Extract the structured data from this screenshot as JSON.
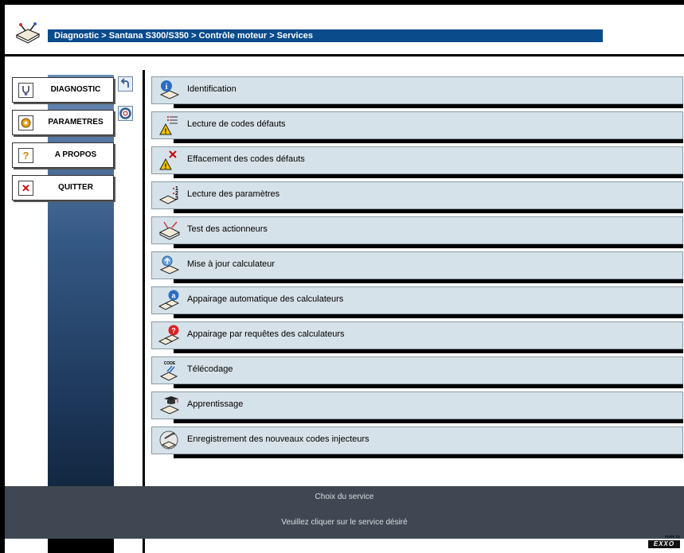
{
  "header": {
    "breadcrumb": "Diagnostic > Santana S300/S350 > Contrôle moteur > Services"
  },
  "nav": {
    "items": [
      {
        "label": "DIAGNOSTIC",
        "icon": "stethoscope-icon"
      },
      {
        "label": "PARAMETRES",
        "icon": "gear-icon"
      },
      {
        "label": "A PROPOS",
        "icon": "question-icon"
      },
      {
        "label": "QUITTER",
        "icon": "close-icon"
      }
    ]
  },
  "tools": [
    {
      "icon": "back-arrow-icon"
    },
    {
      "icon": "help-lifebuoy-icon"
    }
  ],
  "services": [
    {
      "label": "Identification",
      "icon": "identification-icon"
    },
    {
      "label": "Lecture de codes défauts",
      "icon": "read-fault-codes-icon"
    },
    {
      "label": "Effacement des codes défauts",
      "icon": "clear-fault-codes-icon"
    },
    {
      "label": "Lecture des paramètres",
      "icon": "read-parameters-icon"
    },
    {
      "label": "Test des actionneurs",
      "icon": "actuator-test-icon"
    },
    {
      "label": "Mise à jour calculateur",
      "icon": "ecu-update-icon"
    },
    {
      "label": "Appairage automatique des calculateurs",
      "icon": "auto-pairing-icon"
    },
    {
      "label": "Appairage par requêtes des calculateurs",
      "icon": "request-pairing-icon"
    },
    {
      "label": "Télécodage",
      "icon": "telecoding-icon"
    },
    {
      "label": "Apprentissage",
      "icon": "learning-icon"
    },
    {
      "label": "Enregistrement des nouveaux codes injecteurs",
      "icon": "injector-codes-icon"
    }
  ],
  "status": {
    "title": "Choix du service",
    "message": "Veuillez cliquer sur le service désiré"
  },
  "footer": {
    "made_by": "made by",
    "brand": "EXXO"
  },
  "colors": {
    "breadcrumb_bg": "#0a4b8c",
    "service_bg": "#d6e2e9",
    "status_bg": "#3f4852"
  }
}
